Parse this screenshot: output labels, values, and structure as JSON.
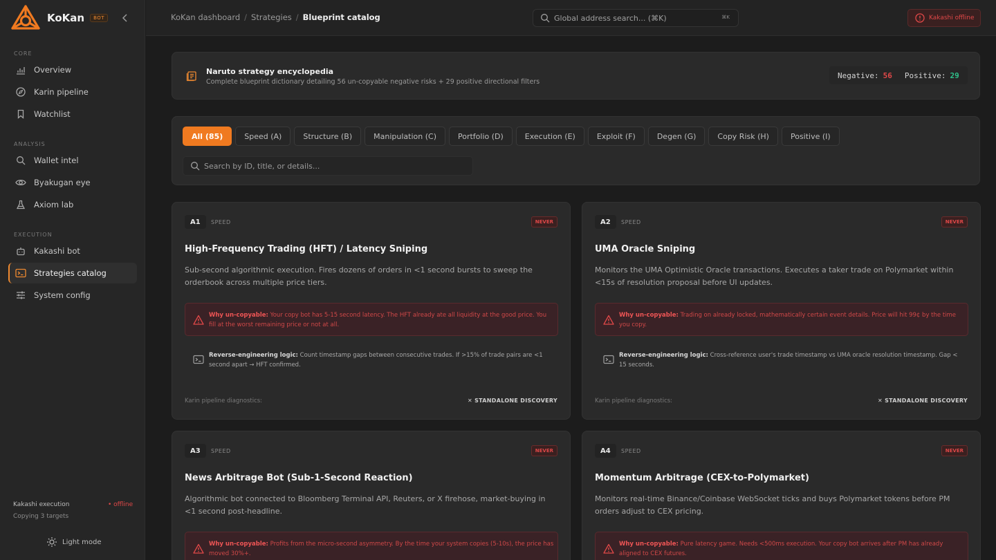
{
  "brand": {
    "name": "KoKan",
    "badge": "BOT"
  },
  "sidebar": {
    "sections": [
      {
        "label": "CORE",
        "items": [
          {
            "label": "Overview",
            "icon": "chart-icon"
          },
          {
            "label": "Karin pipeline",
            "icon": "compass-icon"
          },
          {
            "label": "Watchlist",
            "icon": "bookmark-icon"
          }
        ]
      },
      {
        "label": "ANALYSIS",
        "items": [
          {
            "label": "Wallet intel",
            "icon": "search-icon"
          },
          {
            "label": "Byakugan eye",
            "icon": "eye-icon"
          },
          {
            "label": "Axiom lab",
            "icon": "flask-icon"
          }
        ]
      },
      {
        "label": "EXECUTION",
        "items": [
          {
            "label": "Kakashi bot",
            "icon": "bot-icon"
          },
          {
            "label": "Strategies catalog",
            "icon": "terminal-icon",
            "active": true
          },
          {
            "label": "System config",
            "icon": "sliders-icon"
          }
        ]
      }
    ],
    "footer": {
      "title": "Kakashi execution",
      "status": "• offline",
      "subtitle": "Copying 3 targets",
      "theme_toggle": "Light mode"
    }
  },
  "header": {
    "breadcrumb": [
      "KoKan dashboard",
      "Strategies",
      "Blueprint catalog"
    ],
    "search_placeholder": "Global address search... (⌘K)",
    "search_shortcut": "⌘K",
    "status_pill": "Kakashi offline"
  },
  "banner": {
    "title": "Naruto strategy encyclopedia",
    "subtitle": "Complete blueprint dictionary detailing 56 un-copyable negative risks + 29 positive directional filters",
    "negative_label": "Negative:",
    "negative_count": "56",
    "positive_label": "Positive:",
    "positive_count": "29"
  },
  "filters": {
    "tabs": [
      "All (85)",
      "Speed (A)",
      "Structure (B)",
      "Manipulation (C)",
      "Portfolio (D)",
      "Execution (E)",
      "Exploit (F)",
      "Degen (G)",
      "Copy Risk (H)",
      "Positive (I)"
    ],
    "active_tab": 0,
    "search_placeholder": "Search by ID, title, or details..."
  },
  "cards": [
    {
      "id": "A1",
      "category": "SPEED",
      "badge": "NEVER",
      "title": "High-Frequency Trading (HFT) / Latency Sniping",
      "description": "Sub-second algorithmic execution. Fires dozens of orders in <1 second bursts to sweep the orderbook across multiple price tiers.",
      "warning_label": "Why un-copyable:",
      "warning": "Your copy bot has 5-15 second latency. The HFT already ate all liquidity at the good price. You fill at the worst remaining price or not at all.",
      "logic_label": "Reverse-engineering logic:",
      "logic": "Count timestamp gaps between consecutive trades. If >15% of trade pairs are <1 second apart → HFT confirmed.",
      "diagnostics": "Karin pipeline diagnostics:",
      "discovery": "✕ STANDALONE DISCOVERY"
    },
    {
      "id": "A2",
      "category": "SPEED",
      "badge": "NEVER",
      "title": "UMA Oracle Sniping",
      "description": "Monitors the UMA Optimistic Oracle transactions. Executes a taker trade on Polymarket within <15s of resolution proposal before UI updates.",
      "warning_label": "Why un-copyable:",
      "warning": "Trading on already locked, mathematically certain event details. Price will hit 99¢ by the time you copy.",
      "logic_label": "Reverse-engineering logic:",
      "logic": "Cross-reference user's trade timestamp vs UMA oracle resolution timestamp. Gap < 15 seconds.",
      "diagnostics": "Karin pipeline diagnostics:",
      "discovery": "✕ STANDALONE DISCOVERY"
    },
    {
      "id": "A3",
      "category": "SPEED",
      "badge": "NEVER",
      "title": "News Arbitrage Bot (Sub-1-Second Reaction)",
      "description": "Algorithmic bot connected to Bloomberg Terminal API, Reuters, or X firehose, market-buying in <1 second post-headline.",
      "warning_label": "Why un-copyable:",
      "warning": "Profits from the micro-second asymmetry. By the time your system copies (5-10s), the price has moved 30%+.",
      "logic_label": "",
      "logic": "",
      "diagnostics": "",
      "discovery": ""
    },
    {
      "id": "A4",
      "category": "SPEED",
      "badge": "NEVER",
      "title": "Momentum Arbitrage (CEX-to-Polymarket)",
      "description": "Monitors real-time Binance/Coinbase WebSocket ticks and buys Polymarket tokens before PM orders adjust to CEX pricing.",
      "warning_label": "Why un-copyable:",
      "warning": "Pure latency game. Needs <500ms execution. Your copy bot arrives after PM has already aligned to CEX futures.",
      "logic_label": "",
      "logic": "",
      "diagnostics": "",
      "discovery": ""
    }
  ],
  "colors": {
    "accent": "#f07a20",
    "danger": "#e04848",
    "positive": "#2fc08a",
    "background": "#1c1c1c"
  }
}
